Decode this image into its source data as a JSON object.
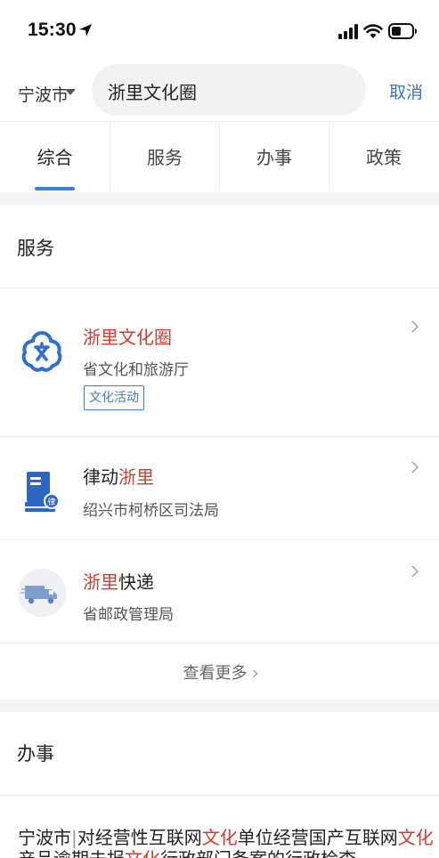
{
  "status": {
    "time": "15:30"
  },
  "search": {
    "city": "宁波市",
    "query": "浙里文化圈",
    "cancel_label": "取消"
  },
  "tabs": [
    {
      "label": "综合",
      "active": true
    },
    {
      "label": "服务"
    },
    {
      "label": "办事"
    },
    {
      "label": "政策"
    }
  ],
  "service_section": {
    "title": "服务",
    "items": [
      {
        "title_hl": "浙里文化圈",
        "title_rest": "",
        "subtitle": "省文化和旅游厅",
        "tag": "文化活动",
        "icon": "culture-icon"
      },
      {
        "title_pre": "律动",
        "title_hl": "浙里",
        "subtitle": "绍兴市柯桥区司法局",
        "icon": "law-book-icon"
      },
      {
        "title_hl": "浙里",
        "title_post": "快递",
        "subtitle": "省邮政管理局",
        "icon": "delivery-truck-icon"
      }
    ],
    "more_label": "查看更多"
  },
  "affairs_section": {
    "title": "办事",
    "result": {
      "city": "宁波市",
      "separator": "|",
      "part1": "对经营性互联网",
      "hl1": "文化",
      "part2": "单位经营国产互联网",
      "hl2": "文化",
      "line2_part1": "产品逾期未报",
      "line2_hl": "文化",
      "line2_part2": "行政部门备案的行政检查"
    }
  },
  "colors": {
    "accent": "#3b82d6",
    "highlight": "#d33a30",
    "link": "#3d72c6"
  }
}
